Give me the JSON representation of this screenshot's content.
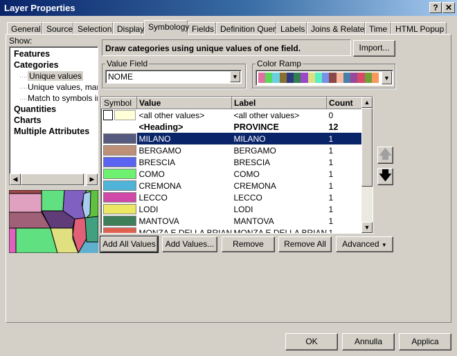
{
  "window": {
    "title": "Layer Properties",
    "help": "?",
    "close": "✕"
  },
  "tabs": [
    "General",
    "Source",
    "Selection",
    "Display",
    "Symbology",
    "Fields",
    "Definition Query",
    "Labels",
    "Joins & Relates",
    "Time",
    "HTML Popup"
  ],
  "active_tab": "Symbology",
  "show": {
    "label": "Show:",
    "items": [
      {
        "label": "Features",
        "level": 0
      },
      {
        "label": "Categories",
        "level": 0
      },
      {
        "label": "Unique values",
        "level": 1,
        "selected": true
      },
      {
        "label": "Unique values, many",
        "level": 1
      },
      {
        "label": "Match to symbols in a",
        "level": 1
      },
      {
        "label": "Quantities",
        "level": 0
      },
      {
        "label": "Charts",
        "level": 0
      },
      {
        "label": "Multiple Attributes",
        "level": 0
      }
    ]
  },
  "description": "Draw categories using unique values of one field.",
  "import_label": "Import...",
  "value_field": {
    "label": "Value Field",
    "value": "NOME"
  },
  "color_ramp": {
    "label": "Color Ramp",
    "colors": [
      "#e070a0",
      "#5ad85a",
      "#6ccfe0",
      "#8a7030",
      "#2e3a80",
      "#308050",
      "#9a48c8",
      "#dde080",
      "#5af0c0",
      "#7890e8",
      "#8a4848",
      "#f8b8a0",
      "#4880a8",
      "#984898",
      "#d84868",
      "#70a038",
      "#f8985a"
    ]
  },
  "table": {
    "headers": {
      "symbol": "Symbol",
      "value": "Value",
      "label": "Label",
      "count": "Count"
    },
    "rows": [
      {
        "value": "<all other values>",
        "label": "<all other values>",
        "count": "0",
        "color": "#ffffd8",
        "other": true
      },
      {
        "value": "<Heading>",
        "label": "PROVINCE",
        "count": "12",
        "heading": true
      },
      {
        "value": "MILANO",
        "label": "MILANO",
        "count": "1",
        "color": "#555a7e",
        "selected": true
      },
      {
        "value": "BERGAMO",
        "label": "BERGAMO",
        "count": "1",
        "color": "#be9078"
      },
      {
        "value": "BRESCIA",
        "label": "BRESCIA",
        "count": "1",
        "color": "#5a64f0"
      },
      {
        "value": "COMO",
        "label": "COMO",
        "count": "1",
        "color": "#6ef070"
      },
      {
        "value": "CREMONA",
        "label": "CREMONA",
        "count": "1",
        "color": "#50b4d8"
      },
      {
        "value": "LECCO",
        "label": "LECCO",
        "count": "1",
        "color": "#d048a8"
      },
      {
        "value": "LODI",
        "label": "LODI",
        "count": "1",
        "color": "#ece864"
      },
      {
        "value": "MANTOVA",
        "label": "MANTOVA",
        "count": "1",
        "color": "#3e7e58"
      },
      {
        "value": "MONZA E DELLA BRIANZA",
        "label": "MONZA E DELLA BRIANZA",
        "count": "1",
        "color": "#e06050"
      }
    ]
  },
  "buttons": {
    "add_all": "Add All Values",
    "add_values": "Add Values...",
    "remove": "Remove",
    "remove_all": "Remove All",
    "advanced": "Advanced",
    "ok": "OK",
    "cancel": "Annulla",
    "apply": "Applica"
  }
}
